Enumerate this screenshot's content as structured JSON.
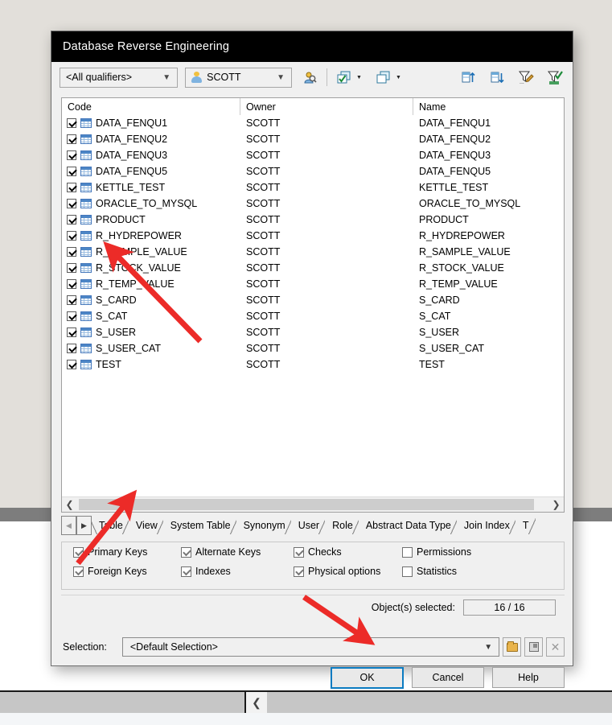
{
  "window": {
    "title": "Database Reverse Engineering"
  },
  "toolbar": {
    "qualifier_value": "<All qualifiers>",
    "owner_value": "SCOTT",
    "icons": [
      "user-filter-icon",
      "select-all-icon",
      "select-all-dropdown-icon",
      "deselect-all-icon",
      "deselect-all-dropdown-icon",
      "sort-ascending-icon",
      "sort-descending-icon",
      "edit-filter-icon",
      "apply-filter-icon"
    ]
  },
  "list": {
    "columns": [
      "Code",
      "Owner",
      "Name"
    ],
    "rows": [
      {
        "checked": true,
        "code": "DATA_FENQU1",
        "owner": "SCOTT",
        "name": "DATA_FENQU1"
      },
      {
        "checked": true,
        "code": "DATA_FENQU2",
        "owner": "SCOTT",
        "name": "DATA_FENQU2"
      },
      {
        "checked": true,
        "code": "DATA_FENQU3",
        "owner": "SCOTT",
        "name": "DATA_FENQU3"
      },
      {
        "checked": true,
        "code": "DATA_FENQU5",
        "owner": "SCOTT",
        "name": "DATA_FENQU5"
      },
      {
        "checked": true,
        "code": "KETTLE_TEST",
        "owner": "SCOTT",
        "name": "KETTLE_TEST"
      },
      {
        "checked": true,
        "code": "ORACLE_TO_MYSQL",
        "owner": "SCOTT",
        "name": "ORACLE_TO_MYSQL"
      },
      {
        "checked": true,
        "code": "PRODUCT",
        "owner": "SCOTT",
        "name": "PRODUCT"
      },
      {
        "checked": true,
        "code": "R_HYDREPOWER",
        "owner": "SCOTT",
        "name": "R_HYDREPOWER"
      },
      {
        "checked": true,
        "code": "R_SAMPLE_VALUE",
        "owner": "SCOTT",
        "name": "R_SAMPLE_VALUE"
      },
      {
        "checked": true,
        "code": "R_STOCK_VALUE",
        "owner": "SCOTT",
        "name": "R_STOCK_VALUE"
      },
      {
        "checked": true,
        "code": "R_TEMP_VALUE",
        "owner": "SCOTT",
        "name": "R_TEMP_VALUE"
      },
      {
        "checked": true,
        "code": "S_CARD",
        "owner": "SCOTT",
        "name": "S_CARD"
      },
      {
        "checked": true,
        "code": "S_CAT",
        "owner": "SCOTT",
        "name": "S_CAT"
      },
      {
        "checked": true,
        "code": "S_USER",
        "owner": "SCOTT",
        "name": "S_USER"
      },
      {
        "checked": true,
        "code": "S_USER_CAT",
        "owner": "SCOTT",
        "name": "S_USER_CAT"
      },
      {
        "checked": true,
        "code": "TEST",
        "owner": "SCOTT",
        "name": "TEST"
      }
    ]
  },
  "tabs": {
    "items": [
      {
        "label": "Table",
        "active": true
      },
      {
        "label": "View",
        "active": false
      },
      {
        "label": "System Table",
        "active": false
      },
      {
        "label": "Synonym",
        "active": false
      },
      {
        "label": "User",
        "active": false
      },
      {
        "label": "Role",
        "active": false
      },
      {
        "label": "Abstract Data Type",
        "active": false
      },
      {
        "label": "Join Index",
        "active": false
      },
      {
        "label": "T",
        "active": false
      }
    ]
  },
  "options": {
    "row1": [
      {
        "label": "Primary Keys",
        "checked": true
      },
      {
        "label": "Alternate Keys",
        "checked": true
      },
      {
        "label": "Checks",
        "checked": true
      },
      {
        "label": "Permissions",
        "checked": false
      }
    ],
    "row2": [
      {
        "label": "Foreign Keys",
        "checked": true
      },
      {
        "label": "Indexes",
        "checked": true
      },
      {
        "label": "Physical options",
        "checked": true
      },
      {
        "label": "Statistics",
        "checked": false
      }
    ]
  },
  "status": {
    "objects_label": "Object(s) selected:",
    "objects_value": "16 / 16"
  },
  "selection": {
    "label": "Selection:",
    "value": "<Default Selection>",
    "buttons": [
      "folder-open-icon",
      "save-icon",
      "delete-icon"
    ]
  },
  "buttons": {
    "ok": "OK",
    "cancel": "Cancel",
    "help": "Help"
  },
  "colors": {
    "titlebar_bg": "#000000",
    "dialog_bg": "#f0f0f0",
    "accent_focus": "#0b7bc1",
    "arrow_red": "#ec2b28",
    "desktop_bg": "#e2dfda"
  }
}
